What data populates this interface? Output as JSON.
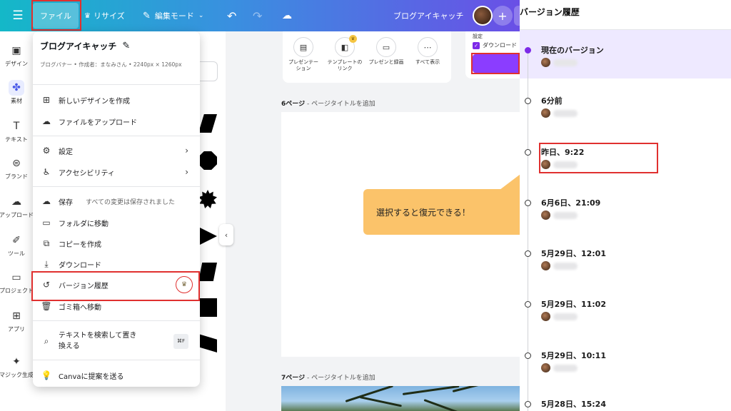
{
  "topbar": {
    "file_label": "ファイル",
    "resize_label": "リサイズ",
    "edit_mode_label": "編集モード",
    "document_title": "ブログアイキャッチ"
  },
  "left_rail": {
    "items": [
      {
        "label": "デザイン",
        "icon": "layout-icon"
      },
      {
        "label": "素材",
        "icon": "elements-icon"
      },
      {
        "label": "テキスト",
        "icon": "text-icon"
      },
      {
        "label": "ブランド",
        "icon": "brand-icon"
      },
      {
        "label": "アップロード",
        "icon": "upload-icon"
      },
      {
        "label": "ツール",
        "icon": "tools-icon"
      },
      {
        "label": "プロジェクト",
        "icon": "folder-icon"
      },
      {
        "label": "アプリ",
        "icon": "apps-icon"
      },
      {
        "label": "マジック生成",
        "icon": "magic-icon"
      }
    ]
  },
  "file_menu": {
    "title": "ブログアイキャッチ",
    "subtitle": "ブログバナー • 作成者：まなみさん • 2240px × 1260px",
    "items": {
      "new_design": "新しいデザインを作成",
      "upload_file": "ファイルをアップロード",
      "settings": "設定",
      "accessibility": "アクセシビリティ",
      "save": "保存",
      "save_status": "すべての変更は保存されました",
      "move_folder": "フォルダに移動",
      "make_copy": "コピーを作成",
      "download": "ダウンロード",
      "version_history": "バージョン履歴",
      "trash": "ゴミ箱へ移動",
      "find_replace_1": "テキストを検索して置き",
      "find_replace_2": "換える",
      "find_replace_shortcut": "⌘F",
      "suggest": "Canvaに提案を送る"
    }
  },
  "tool_panel": {
    "tools": [
      {
        "label": "プレゼンテー\nション",
        "icon": "presentation-icon"
      },
      {
        "label": "テンプレートの\nリンク",
        "icon": "template-link-icon"
      },
      {
        "label": "プレゼンと録画",
        "icon": "record-icon"
      },
      {
        "label": "すべて表示",
        "icon": "more-icon"
      }
    ]
  },
  "download_panel": {
    "settings_label": "設定",
    "checkbox_label": "ダウンロード"
  },
  "pages": {
    "page6_number": "6ページ",
    "page6_title": "ページタイトルを追加",
    "page7_number": "7ページ",
    "page7_title": "ページタイトルを追加"
  },
  "callout": {
    "text": "選択すると復元できる！"
  },
  "version_panel": {
    "title": "バージョン履歴",
    "entries": [
      {
        "label": "現在のバージョン",
        "current": true
      },
      {
        "label": "6分前"
      },
      {
        "label": "昨日、9:22"
      },
      {
        "label": "6月6日、21:09"
      },
      {
        "label": "5月29日、12:01"
      },
      {
        "label": "5月29日、11:02"
      },
      {
        "label": "5月29日、10:11"
      },
      {
        "label": "5月28日、15:24"
      }
    ]
  },
  "colors": {
    "accent_purple": "#7d2ae8",
    "highlight_red": "#e0302f",
    "callout_yellow": "#fbc36a"
  }
}
